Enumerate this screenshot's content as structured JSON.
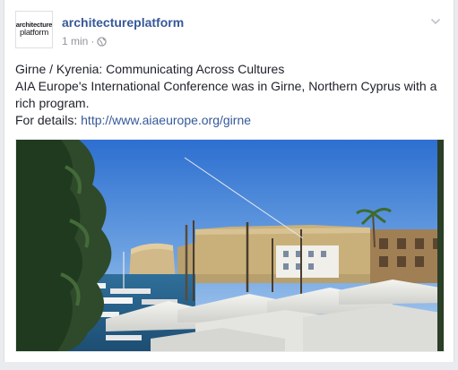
{
  "post": {
    "author": "architectureplatform",
    "avatar": {
      "line1": "architecture",
      "line2": "platform"
    },
    "timestamp": "1 min",
    "meta_separator": "·",
    "privacy_icon": "globe-icon",
    "menu_icon": "chevron-down-icon",
    "text": {
      "title": "Girne / Kyrenia: Communicating Across Cultures",
      "description": "AIA Europe's International Conference was in Girne, Northern Cyprus with a rich program.",
      "details_prefix": "For details: ",
      "link": "http://www.aiaeurope.org/girne"
    },
    "photo_icon": "harbour-photo"
  },
  "colors": {
    "author": "#365899",
    "link": "#365899",
    "text": "#1d2129",
    "meta": "#90949c",
    "background": "#e9ebee"
  }
}
